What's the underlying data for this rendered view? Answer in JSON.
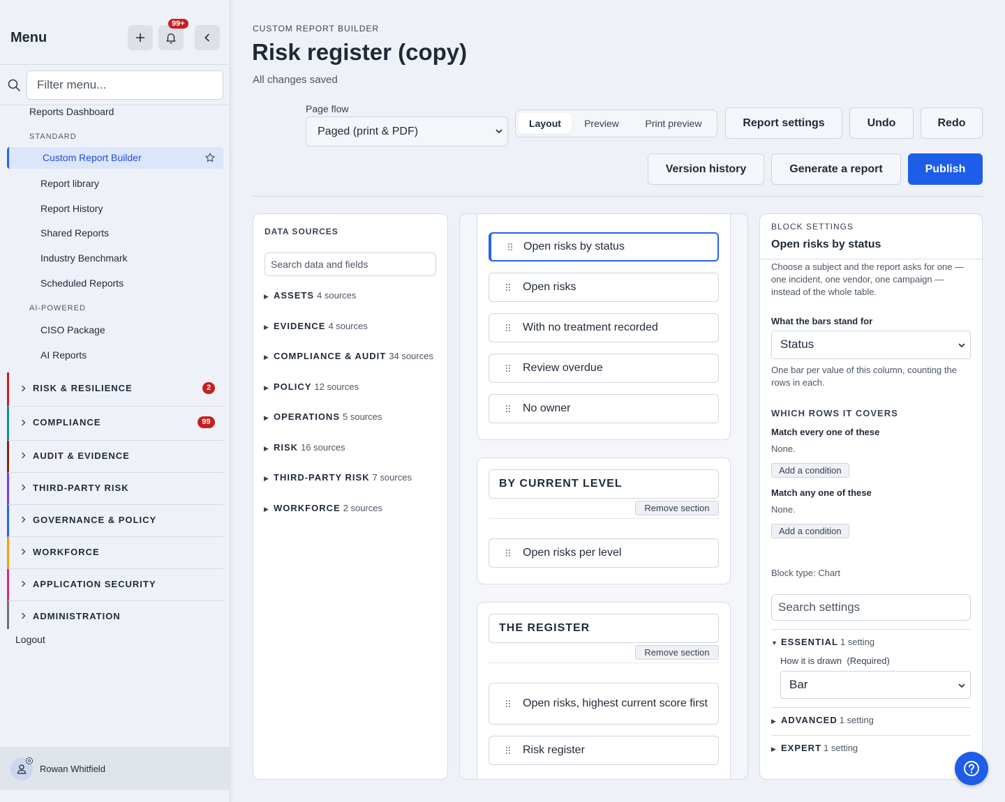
{
  "sidebar": {
    "title": "Menu",
    "notif_badge": "99+",
    "filter_placeholder": "Filter menu...",
    "reports_dashboard": "Reports Dashboard",
    "standard_caption": "STANDARD",
    "active_item": "Custom Report Builder",
    "standard_items": [
      "Report library",
      "Report History",
      "Shared Reports",
      "Industry Benchmark",
      "Scheduled Reports"
    ],
    "ai_caption": "AI-POWERED",
    "ai_items": [
      "CISO Package",
      "AI Reports"
    ],
    "groups": [
      {
        "label": "RISK & RESILIENCE",
        "badge": "2",
        "color": "#c81e1e"
      },
      {
        "label": "COMPLIANCE",
        "badge": "99",
        "color": "#0d9488"
      },
      {
        "label": "AUDIT & EVIDENCE",
        "badge": "",
        "color": "#7c2d12"
      },
      {
        "label": "THIRD-PARTY RISK",
        "badge": "",
        "color": "#7c3aed"
      },
      {
        "label": "GOVERNANCE & POLICY",
        "badge": "",
        "color": "#2563eb"
      },
      {
        "label": "WORKFORCE",
        "badge": "",
        "color": "#f59e0b"
      },
      {
        "label": "APPLICATION SECURITY",
        "badge": "",
        "color": "#db2777"
      },
      {
        "label": "ADMINISTRATION",
        "badge": "",
        "color": "#6b7280"
      }
    ],
    "logout": "Logout",
    "user_name": "Rowan Whitfield"
  },
  "header": {
    "breadcrumb": "CUSTOM REPORT BUILDER",
    "title": "Risk register (copy)",
    "saved_status": "All changes saved",
    "page_flow_label": "Page flow",
    "page_flow_value": "Paged (print & PDF)",
    "view_tabs": [
      "Layout",
      "Preview",
      "Print preview"
    ],
    "active_tab": "Layout",
    "report_settings": "Report settings",
    "undo": "Undo",
    "redo": "Redo",
    "version_history": "Version history",
    "generate": "Generate a report",
    "publish": "Publish"
  },
  "data_sources": {
    "title": "DATA SOURCES",
    "search_placeholder": "Search data and fields",
    "items": [
      {
        "name": "ASSETS",
        "count": "4 sources"
      },
      {
        "name": "EVIDENCE",
        "count": "4 sources"
      },
      {
        "name": "COMPLIANCE & AUDIT",
        "count": "34 sources"
      },
      {
        "name": "POLICY",
        "count": "12 sources"
      },
      {
        "name": "OPERATIONS",
        "count": "5 sources"
      },
      {
        "name": "RISK",
        "count": "16 sources"
      },
      {
        "name": "THIRD-PARTY RISK",
        "count": "7 sources"
      },
      {
        "name": "WORKFORCE",
        "count": "2 sources"
      }
    ]
  },
  "canvas": {
    "section1_blocks": [
      "Open risks by status",
      "Open risks",
      "With no treatment recorded",
      "Review overdue",
      "No owner"
    ],
    "section2_title": "BY CURRENT LEVEL",
    "section2_blocks": [
      "Open risks per level"
    ],
    "section3_title": "THE REGISTER",
    "section3_blocks": [
      "Open risks, highest current score first",
      "Risk register"
    ],
    "remove_section": "Remove section"
  },
  "block_settings": {
    "caption": "BLOCK SETTINGS",
    "title": "Open risks by status",
    "intro": "Choose a subject and the report asks for one — one incident, one vendor, one campaign — instead of the whole table.",
    "bars_label": "What the bars stand for",
    "bars_value": "Status",
    "bars_help": "One bar per value of this column, counting the rows in each.",
    "rows_caption": "WHICH ROWS IT COVERS",
    "match_all_label": "Match every one of these",
    "match_all_value": "None.",
    "add_condition": "Add a condition",
    "match_any_label": "Match any one of these",
    "match_any_value": "None.",
    "block_type": "Block type: Chart",
    "search_placeholder": "Search settings",
    "essential": {
      "name": "ESSENTIAL",
      "count": "1 setting"
    },
    "how_drawn_label": "How it is drawn",
    "how_drawn_required": "(Required)",
    "how_drawn_value": "Bar",
    "advanced": {
      "name": "ADVANCED",
      "count": "1 setting"
    },
    "expert": {
      "name": "EXPERT",
      "count": "1 setting"
    }
  }
}
